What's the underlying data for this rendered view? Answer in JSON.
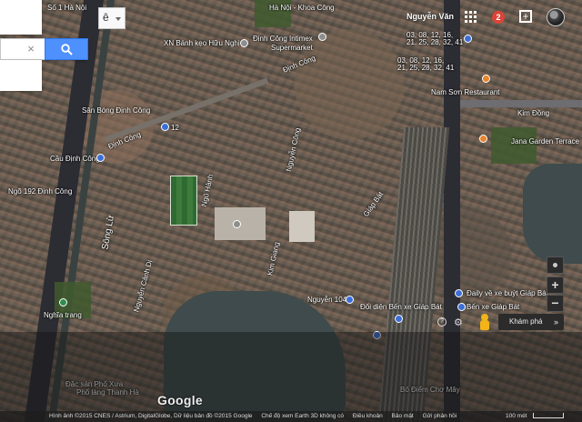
{
  "map_labels": {
    "so1_ha_noi": "Số 1 Hà Nội",
    "ha_noi_khoa_cong": "Hà Nội - Khoa Công",
    "xn_banh_keo": "XN Bánh kẹo Hữu Nghị",
    "dinh_cong_intimex": "Định Công Intimex",
    "supermarket": "Supermarket",
    "dinh_cong_road1": "Định Công",
    "dinh_cong_road2": "Định Công",
    "bus_times": "03, 08, 12, 16,",
    "bus_times2": "21, 25, 28, 32, 41",
    "bus_times3": "03, 08, 12, 16,",
    "bus_times4": "21, 25, 28, 32, 41",
    "nam_son": "Nam Sơn Restaurant",
    "kim_dong": "Kim Đồng",
    "jana_garden": "Jana Garden Terrace",
    "san_bong": "Sân Bóng Định Công",
    "route12": "12",
    "cau_dinh_cong": "Cầu Định Công",
    "ngo_192": "Ngõ 192 Định Công",
    "song_lu": "Sông Lừ",
    "nguyen_canh_di": "Nguyễn Cảnh Dị",
    "nghia_trang": "Nghĩa trang",
    "ngu_hanh": "Ngũ Hành",
    "nguyen_104": "Nguyễn 104",
    "doi_dien_ben_xe": "Đối diện Bến xe Giáp Bát",
    "ben_xe_giap_bat": "Bến xe Giáp Bát",
    "daily_ve_xe_buyt": "Đaily về xe buýt Giáp Bát",
    "dac_san": "Đặc sản Phố Xưa",
    "pho_lang": "Phố làng Thanh Hà",
    "bo_diem_cho_may": "Bố Điểm Chợ Mây",
    "giap_bat": "Giáp Bát",
    "kim_giang": "Kim Giang",
    "nguyen_cong": "Nguyễn Công"
  },
  "ui": {
    "language_value": "ê",
    "search_placeholder": "",
    "search_value": "",
    "clear_glyph": "×",
    "user_name": "Nguyễn Văn",
    "notification_count": "2",
    "share_glyph": "+",
    "zoom_in": "+",
    "zoom_out": "−",
    "explore_label": "Khám phá",
    "explore_chevron": "»",
    "help_glyph": "?",
    "gear_glyph": "⚙",
    "google_logo": "Google"
  },
  "footer": {
    "imagery": "Hình ảnh ©2015 CNES / Astrium, DigitalGlobe, Dữ liệu bản đồ ©2015 Google",
    "earth_mode": "Chế độ xem Earth 3D không có",
    "terms": "Điều khoản",
    "privacy": "Bảo mật",
    "feedback": "Gửi phản hồi",
    "scale": "100 mét"
  },
  "colors": {
    "search_button": "#4d90fe",
    "notification": "#db4437",
    "pegman": "#f2b417"
  }
}
